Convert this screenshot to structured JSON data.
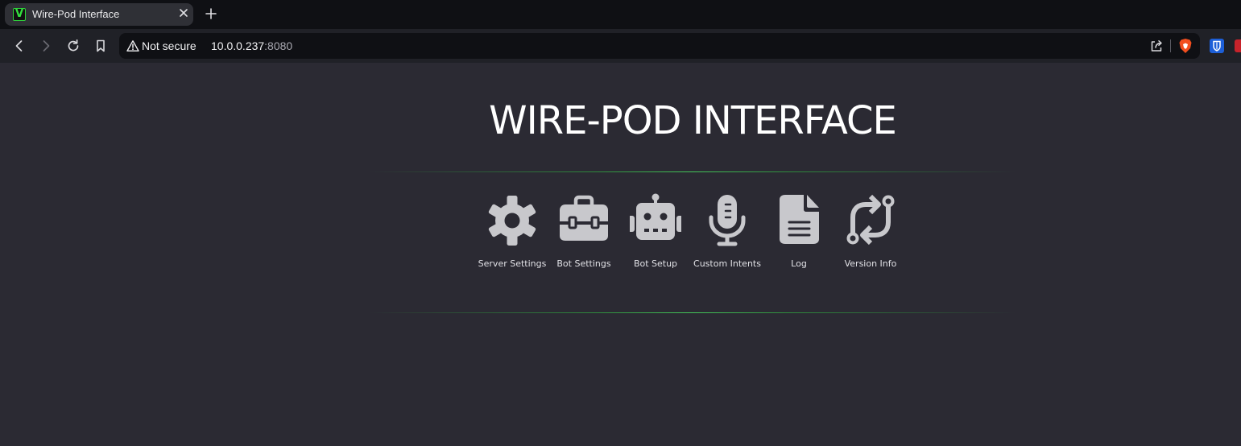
{
  "browser": {
    "tab": {
      "favicon_letter": "V",
      "title": "Wire-Pod Interface"
    },
    "address_bar": {
      "security_label": "Not secure",
      "url_host": "10.0.0.237",
      "url_port": ":8080"
    },
    "icons": {
      "back": "back-icon",
      "forward": "forward-icon",
      "reload": "reload-icon",
      "bookmark": "bookmark-icon",
      "share": "share-icon",
      "brave": "brave-shield-icon",
      "bitwarden": "bitwarden-icon"
    }
  },
  "page": {
    "heading": "WIRE-POD INTERFACE",
    "accent_color": "#45c75a",
    "icon_color": "#c8c8cc",
    "menu": [
      {
        "label": "Server Settings",
        "icon": "gear-icon"
      },
      {
        "label": "Bot Settings",
        "icon": "toolbox-icon"
      },
      {
        "label": "Bot Setup",
        "icon": "robot-icon"
      },
      {
        "label": "Custom Intents",
        "icon": "microphone-icon"
      },
      {
        "label": "Log",
        "icon": "file-icon"
      },
      {
        "label": "Version Info",
        "icon": "sync-arrows-icon"
      }
    ]
  }
}
